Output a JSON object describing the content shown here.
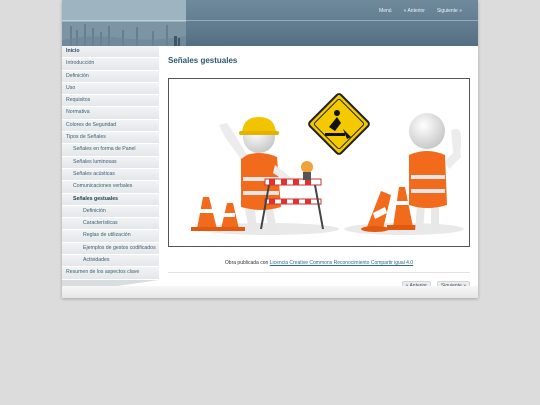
{
  "top_nav": {
    "menu": "Menú",
    "prev": "« Anterior",
    "next": "Siguiente »"
  },
  "sidebar": {
    "items": [
      {
        "label": "Inicio",
        "level": 0
      },
      {
        "label": "Introducción",
        "level": 0
      },
      {
        "label": "Definición",
        "level": 0
      },
      {
        "label": "Uso",
        "level": 0
      },
      {
        "label": "Requisitos",
        "level": 0
      },
      {
        "label": "Normativa",
        "level": 0
      },
      {
        "label": "Colores de Seguridad",
        "level": 0
      },
      {
        "label": "Tipos de Señales",
        "level": 0
      },
      {
        "label": "Señales en forma de Panel",
        "level": 1
      },
      {
        "label": "Señales luminosas",
        "level": 1
      },
      {
        "label": "Señales acústicas",
        "level": 1
      },
      {
        "label": "Comunicaciones verbales",
        "level": 1
      },
      {
        "label": "Señales gestuales",
        "level": 1
      },
      {
        "label": "Definición",
        "level": 2
      },
      {
        "label": "Características",
        "level": 2
      },
      {
        "label": "Reglas de utilización",
        "level": 2
      },
      {
        "label": "Ejemplos de gestos codificados",
        "level": 2
      },
      {
        "label": "Actividades",
        "level": 2
      },
      {
        "label": "Resumen de los aspectos clave",
        "level": 0
      }
    ]
  },
  "main": {
    "title": "Señales gestuales",
    "credit_prefix": "Obra publicada con",
    "credit_link": "Licencia Creative Commons Reconocimiento Compartir igual 4.0"
  },
  "bottom_nav": {
    "prev": "« Anterior",
    "next": "Siguiente »"
  },
  "colors": {
    "header": "#5f7b8d",
    "title": "#2a5a70",
    "sidebar_text": "#3b5d70"
  }
}
